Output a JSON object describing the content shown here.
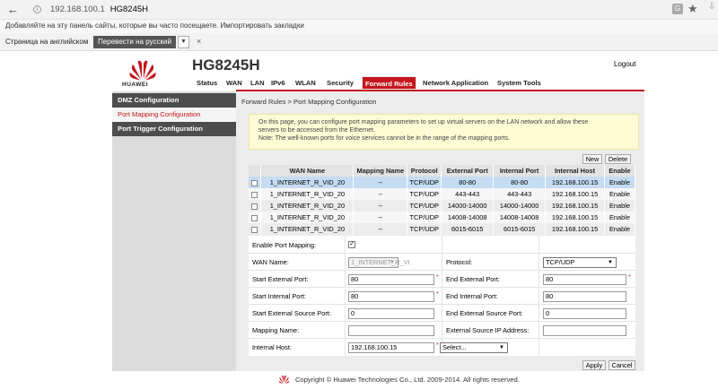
{
  "browser": {
    "back_glyph": "←",
    "info_glyph": "i",
    "url": "192.168.100.1",
    "page_title": "HG8245H",
    "translate_glyph": "G",
    "star_glyph": "★",
    "download_glyph": "⇩",
    "bookmarks_hint": "Добавляйте на эту панель сайты, которые вы часто посещаете. Импортировать закладки",
    "translate_label": "Страница на английском",
    "translate_button": "Перевести на русский",
    "translate_close": "×"
  },
  "router": {
    "brand": "HUAWEI",
    "model": "HG8245H",
    "logout": "Logout",
    "nav": [
      "Status",
      "WAN",
      "LAN",
      "IPv6",
      "WLAN",
      "Security",
      "Forward Rules",
      "Network Application",
      "System Tools"
    ],
    "active_nav": "Forward Rules",
    "accent_color": "#c4161c",
    "sidebar": [
      "DMZ Configuration",
      "Port Mapping Configuration",
      "Port Trigger Configuration"
    ],
    "breadcrumb": "Forward Rules > Port Mapping Configuration",
    "note_lines": [
      "On this page, you can configure port mapping parameters to set up virtual servers on the LAN network and allow these",
      "servers to be accessed from the Ethernet.",
      "Note: The well-known ports for voice services cannot be in the range of the mapping ports."
    ],
    "buttons": {
      "new": "New",
      "delete": "Delete",
      "apply": "Apply",
      "cancel": "Cancel"
    },
    "table": {
      "headers": [
        "",
        "WAN Name",
        "Mapping Name",
        "Protocol",
        "External Port",
        "Internal Port",
        "Internal Host",
        "Enable"
      ],
      "rows": [
        [
          "1_INTERNET_R_VID_20",
          "--",
          "TCP/UDP",
          "80-80",
          "80-80",
          "192.168.100.15",
          "Enable"
        ],
        [
          "1_INTERNET_R_VID_20",
          "--",
          "TCP/UDP",
          "443-443",
          "443-443",
          "192.168.100.15",
          "Enable"
        ],
        [
          "1_INTERNET_R_VID_20",
          "--",
          "TCP/UDP",
          "14000-14000",
          "14000-14000",
          "192.168.100.15",
          "Enable"
        ],
        [
          "1_INTERNET_R_VID_20",
          "--",
          "TCP/UDP",
          "14008-14008",
          "14008-14008",
          "192.168.100.15",
          "Enable"
        ],
        [
          "1_INTERNET_R_VID_20",
          "--",
          "TCP/UDP",
          "6015-6015",
          "6015-6015",
          "192.168.100.15",
          "Enable"
        ]
      ]
    },
    "form": {
      "enable_label": "Enable Port Mapping:",
      "wan_label": "WAN Name:",
      "wan_value": "1_INTERNET_R_VI",
      "protocol_label": "Protocol:",
      "protocol_value": "TCP/UDP",
      "start_ext_label": "Start External Port:",
      "start_ext_value": "80",
      "end_ext_label": "End External Port:",
      "end_ext_value": "80",
      "start_int_label": "Start Internal Port:",
      "start_int_value": "80",
      "end_int_label": "End Internal Port:",
      "end_int_value": "80",
      "start_src_label": "Start External Source Port:",
      "start_src_value": "0",
      "end_src_label": "End External Source Port:",
      "end_src_value": "0",
      "mapping_name_label": "Mapping Name:",
      "mapping_name_value": "",
      "ext_src_ip_label": "External Source IP Address:",
      "ext_src_ip_value": "",
      "internal_host_label": "Internal Host:",
      "internal_host_value": "192.168.100.15",
      "select_value": "Select...",
      "required_mark": "*",
      "check_mark": "✓",
      "dropdown_glyph": "▼"
    },
    "footer": "Copyright © Huawei Technologies Co., Ltd. 2009-2014. All rights reserved."
  }
}
